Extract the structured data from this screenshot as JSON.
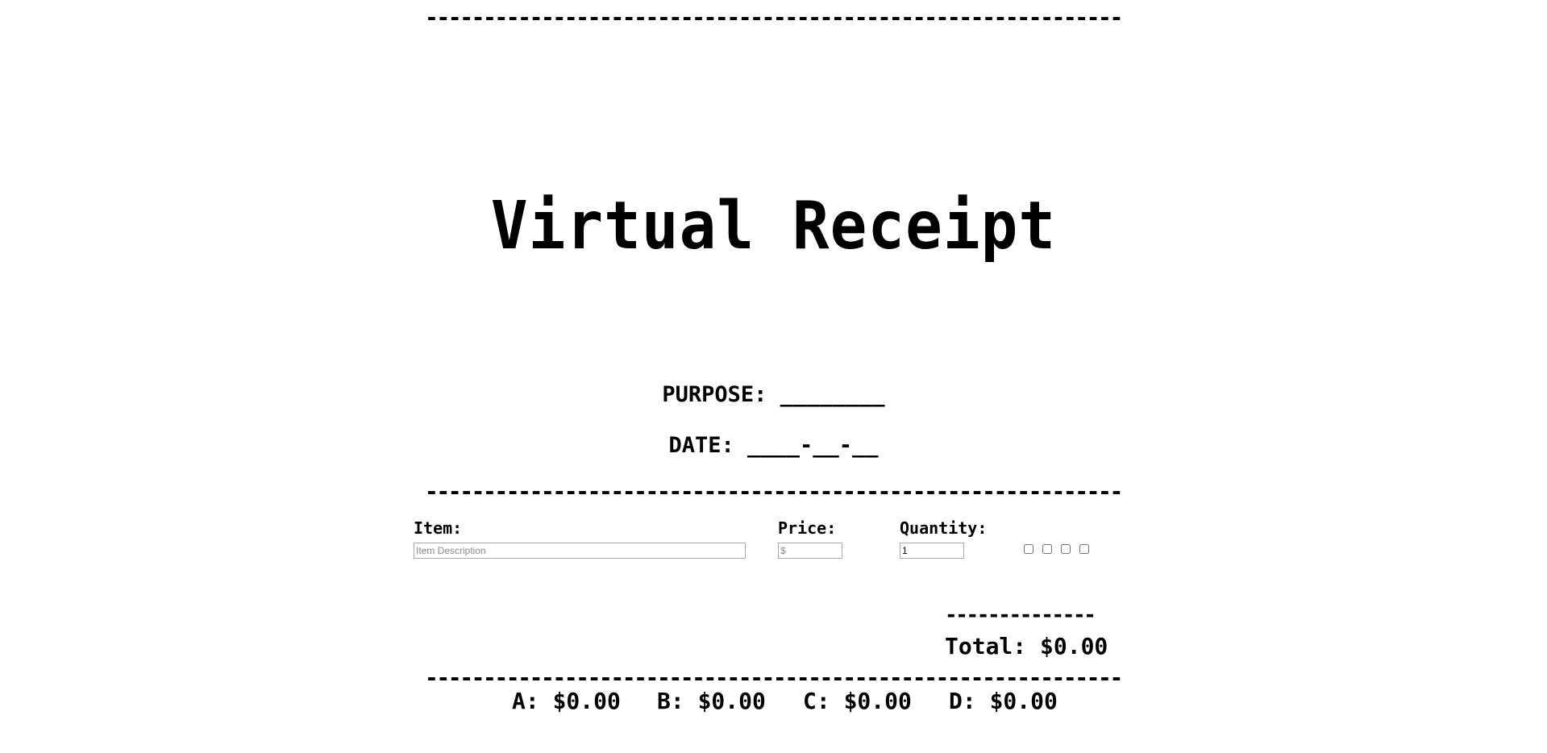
{
  "dividers": {
    "top": "---------------------------------------------------------------------",
    "middle": "---------------------------------------------------------------------",
    "bottom": "---------------------------------------------------------------------"
  },
  "title": "Virtual Receipt",
  "purpose": "PURPOSE: ________",
  "date": "DATE: ____-__-__",
  "item_row": {
    "item_label": "Item:",
    "price_label": "Price:",
    "quantity_label": "Quantity:",
    "item_placeholder": "Item Description",
    "price_placeholder": "$",
    "quantity_value": "1",
    "checkboxes": [
      {
        "name": "A",
        "checked": false
      },
      {
        "name": "B",
        "checked": false
      },
      {
        "name": "C",
        "checked": false
      },
      {
        "name": "D",
        "checked": false
      }
    ]
  },
  "subtotal_rule": "--------------",
  "total": "Total: $0.00",
  "splits": {
    "a": "A: $0.00",
    "b": "B: $0.00",
    "c": "C: $0.00",
    "d": "D: $0.00"
  }
}
